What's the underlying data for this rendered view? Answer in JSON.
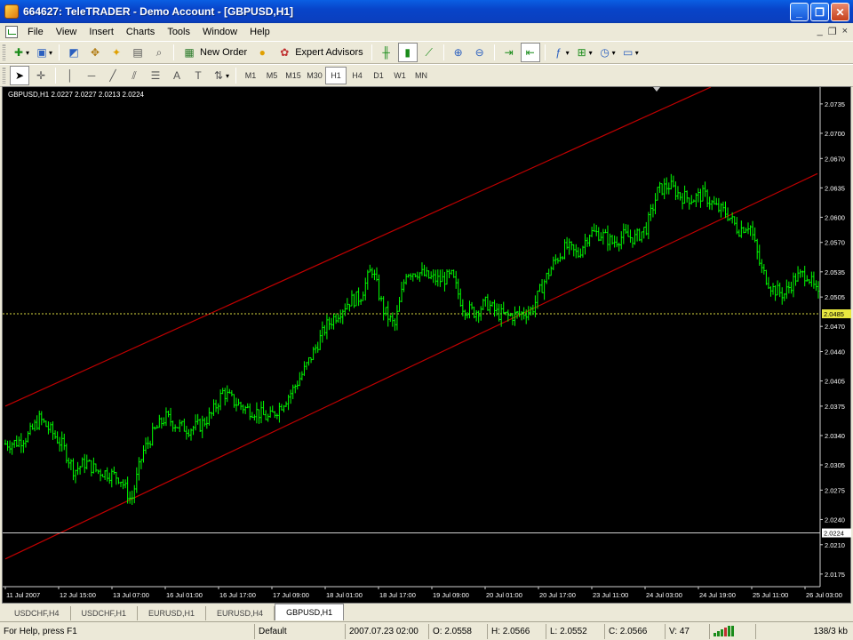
{
  "window": {
    "title": "664627: TeleTRADER - Demo Account - [GBPUSD,H1]",
    "buttons": [
      "_",
      "❐",
      "✕"
    ]
  },
  "menu": {
    "items": [
      "File",
      "View",
      "Insert",
      "Charts",
      "Tools",
      "Window",
      "Help"
    ],
    "mdi_buttons": [
      "_",
      "❐",
      "×"
    ]
  },
  "toolbar": {
    "new_order_label": "New Order",
    "expert_advisors_label": "Expert Advisors"
  },
  "timeframes": [
    "M1",
    "M5",
    "M15",
    "M30",
    "H1",
    "H4",
    "D1",
    "W1",
    "MN"
  ],
  "active_timeframe": "H1",
  "chart": {
    "info_label": "GBPUSD,H1  2.0227 2.0227 2.0213 2.0224",
    "current_price_label": "2.0224",
    "bid_line_label": "2.0485"
  },
  "chart_data": {
    "type": "bar",
    "symbol": "GBPUSD",
    "timeframe": "H1",
    "ohlc_header": {
      "open": 2.0227,
      "high": 2.0227,
      "low": 2.0213,
      "close": 2.0224
    },
    "yticks": [
      "2.0735",
      "2.0700",
      "2.0670",
      "2.0635",
      "2.0600",
      "2.0570",
      "2.0535",
      "2.0505",
      "2.0470",
      "2.0440",
      "2.0405",
      "2.0375",
      "2.0340",
      "2.0305",
      "2.0275",
      "2.0240",
      "2.0210",
      "2.0175"
    ],
    "xticks": [
      "11 Jul 2007",
      "12 Jul 15:00",
      "13 Jul 07:00",
      "16 Jul 01:00",
      "16 Jul 17:00",
      "17 Jul 09:00",
      "18 Jul 01:00",
      "18 Jul 17:00",
      "19 Jul 09:00",
      "20 Jul 01:00",
      "20 Jul 17:00",
      "23 Jul 11:00",
      "24 Jul 03:00",
      "24 Jul 19:00",
      "25 Jul 11:00",
      "26 Jul 03:00"
    ],
    "ylim": [
      2.016,
      2.0755
    ],
    "price_path": [
      2.033,
      2.0332,
      2.034,
      2.036,
      2.0345,
      2.0328,
      2.0298,
      2.0308,
      2.0298,
      2.0295,
      2.029,
      2.0262,
      2.032,
      2.0345,
      2.0362,
      2.0352,
      2.0348,
      2.0352,
      2.0365,
      2.0392,
      2.038,
      2.0372,
      2.0368,
      2.036,
      2.0375,
      2.0392,
      2.0415,
      2.0442,
      2.047,
      2.0485,
      2.05,
      2.0505,
      2.054,
      2.049,
      2.047,
      2.0535,
      2.0535,
      2.0528,
      2.0525,
      2.053,
      2.0492,
      2.0487,
      2.0498,
      2.0485,
      2.0482,
      2.0485,
      2.049,
      2.0522,
      2.0548,
      2.0565,
      2.0555,
      2.0582,
      2.058,
      2.057,
      2.0578,
      2.0575,
      2.0588,
      2.0632,
      2.0638,
      2.0625,
      2.0622,
      2.0627,
      2.0612,
      2.0605,
      2.0585,
      2.0592,
      2.0538,
      2.0515,
      2.0508,
      2.0528,
      2.0533,
      2.0505
    ],
    "channel_upper": {
      "from": [
        "11 Jul 2007",
        2.0375
      ],
      "to": [
        "24 Jul 19:00",
        2.0755
      ]
    },
    "channel_lower": {
      "from": [
        "11 Jul 2007",
        2.0193
      ],
      "to": [
        "26 Jul 03:00",
        2.0652
      ]
    },
    "bid_line": 2.0485,
    "current_price_line": 2.0224,
    "colors": {
      "background": "#000000",
      "bars": "#00ff00",
      "channel": "#c00000",
      "grid_text": "#ffffff",
      "bid_line": "#d8d840",
      "current_price_line": "#d0d0d0"
    },
    "grid": false
  },
  "tabs": [
    {
      "label": "USDCHF,H4",
      "active": false
    },
    {
      "label": "USDCHF,H1",
      "active": false
    },
    {
      "label": "EURUSD,H1",
      "active": false
    },
    {
      "label": "EURUSD,H4",
      "active": false
    },
    {
      "label": "GBPUSD,H1",
      "active": true
    }
  ],
  "status": {
    "help": "For Help, press F1",
    "profile": "Default",
    "datetime": "2007.07.23 02:00",
    "open": "O: 2.0558",
    "high": "H: 2.0566",
    "low": "L: 2.0552",
    "close": "C: 2.0566",
    "volume": "V: 47",
    "traffic": "138/3 kb"
  }
}
